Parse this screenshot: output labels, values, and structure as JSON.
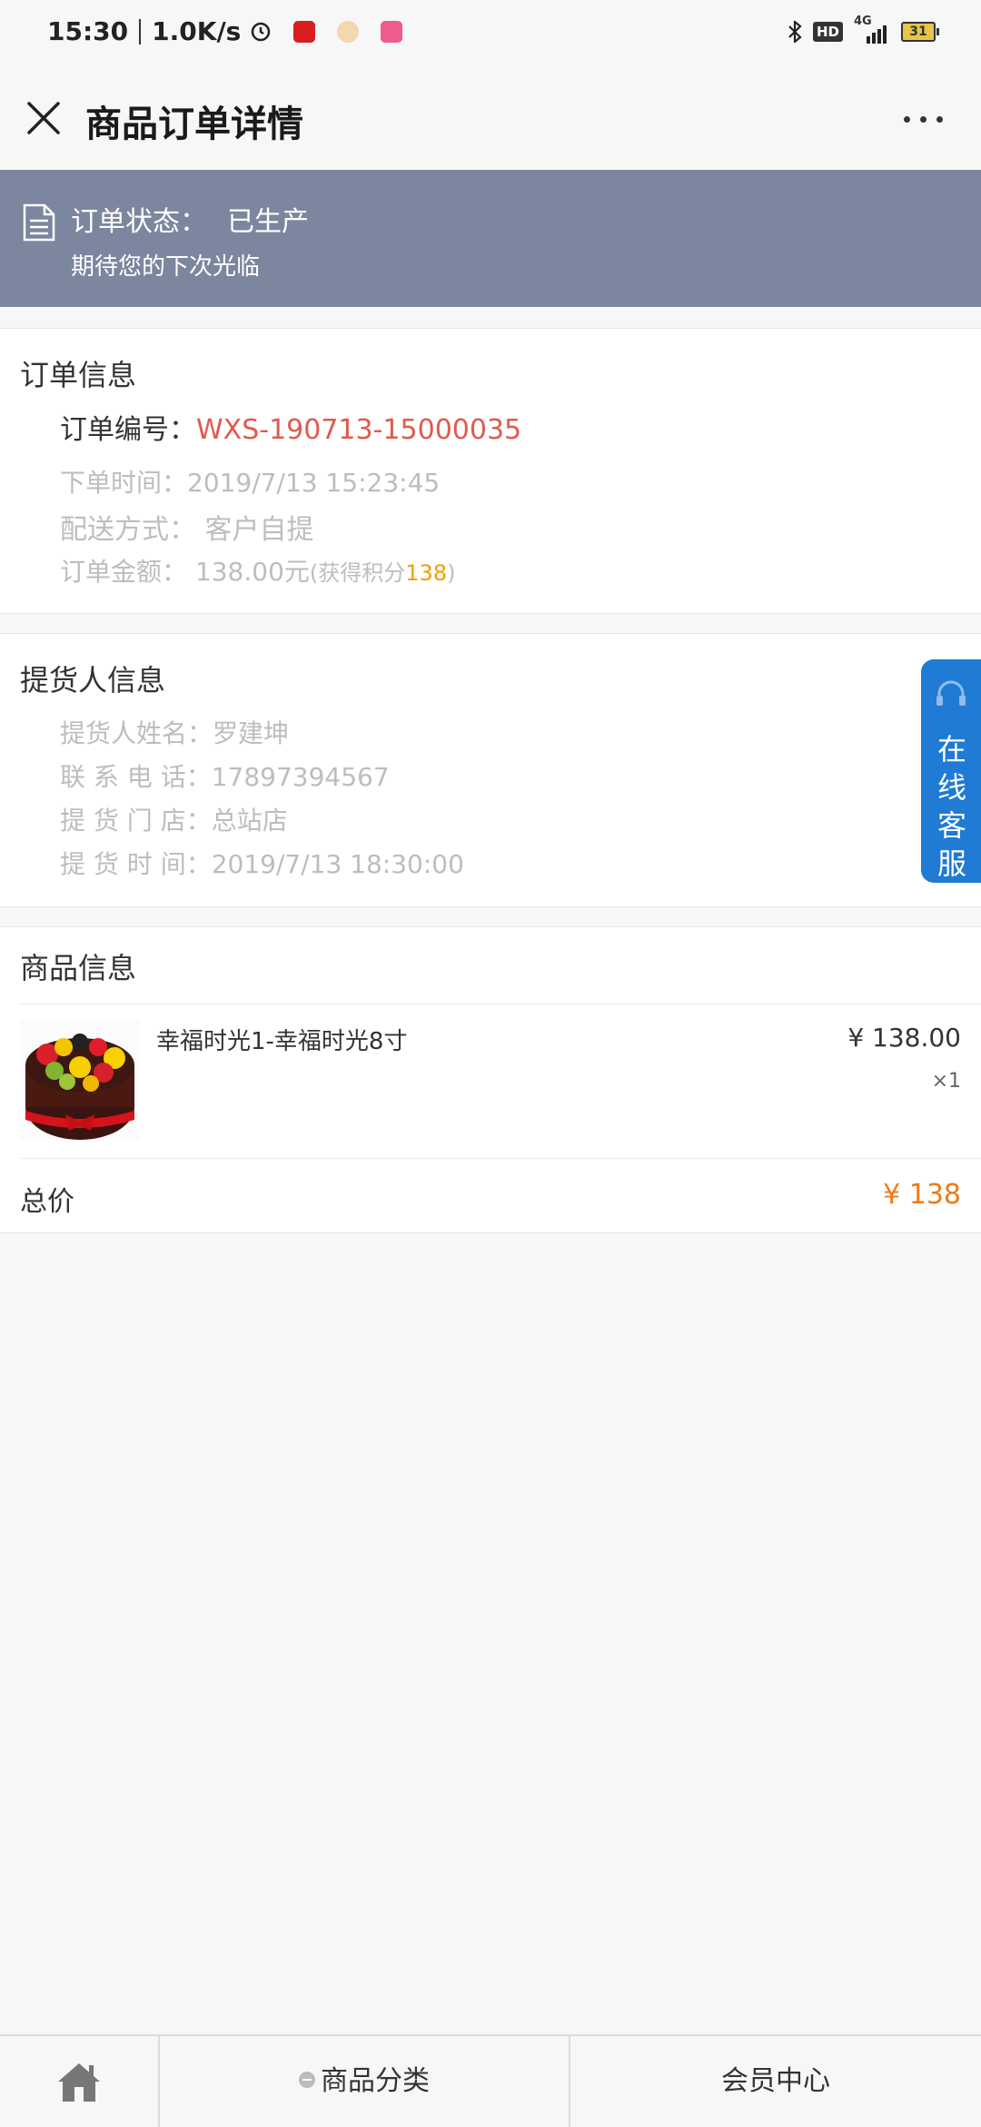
{
  "status_bar": {
    "time": "15:30",
    "speed": "1.0K/s",
    "hd": "HD",
    "network": "4G",
    "battery": "31"
  },
  "header": {
    "title": "商品订单详情"
  },
  "order_status": {
    "label": "订单状态：",
    "value": "已生产",
    "message": "期待您的下次光临"
  },
  "order_info": {
    "title": "订单信息",
    "order_no_label": "订单编号：",
    "order_no": "WXS-190713-15000035",
    "time_label": "下单时间：",
    "time": "2019/7/13 15:23:45",
    "delivery_label": "配送方式：",
    "delivery": "客户自提",
    "amount_label": "订单金额：",
    "amount": "138.00元",
    "points_prefix": "(获得积分",
    "points": "138",
    "points_suffix": ")"
  },
  "pickup_info": {
    "title": "提货人信息",
    "name_label": "提货人姓名：",
    "name": "罗建坤",
    "phone_label": "联 系 电 话：",
    "phone": "17897394567",
    "store_label": "提 货 门 店：",
    "store": "总站店",
    "pickup_time_label": "提 货 时 间：",
    "pickup_time": "2019/7/13 18:30:00"
  },
  "customer_service": {
    "label": "在线客服"
  },
  "product_info": {
    "title": "商品信息",
    "items": [
      {
        "name": "幸福时光1-幸福时光8寸",
        "price": "¥ 138.00",
        "qty": "×1"
      }
    ],
    "total_label": "总价",
    "total": "¥ 138"
  },
  "bottom_nav": {
    "category_label": "商品分类",
    "member_label": "会员中心"
  },
  "colors": {
    "banner": "#7c869e",
    "order_no": "#e05a4e",
    "total": "#f07a18",
    "points": "#f0a000",
    "service_tab": "#1f7bd4"
  }
}
